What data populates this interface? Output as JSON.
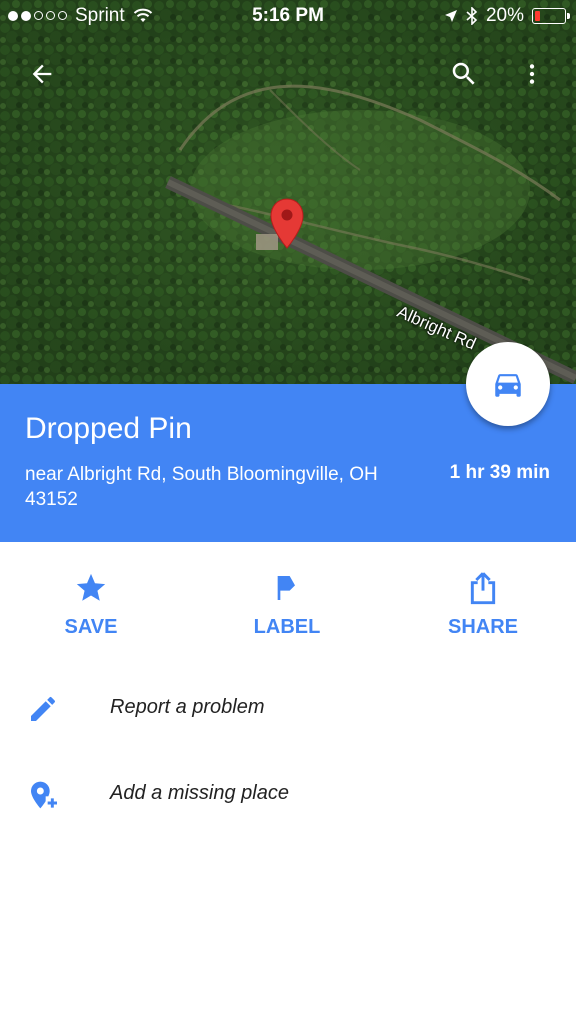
{
  "status_bar": {
    "carrier": "Sprint",
    "time": "5:16 PM",
    "battery": "20%",
    "battery_level": 0.2
  },
  "map": {
    "road_label": "Albright Rd"
  },
  "place": {
    "title": "Dropped Pin",
    "address": "near Albright Rd, South Bloomingville, OH 43152",
    "eta": "1 hr 39 min"
  },
  "actions": [
    {
      "label": "SAVE",
      "icon": "star-icon"
    },
    {
      "label": "LABEL",
      "icon": "flag-icon"
    },
    {
      "label": "SHARE",
      "icon": "share-icon"
    }
  ],
  "list": [
    {
      "label": "Report a problem",
      "icon": "pencil-icon"
    },
    {
      "label": "Add a missing place",
      "icon": "add-place-icon"
    }
  ],
  "colors": {
    "accent": "#4285f4",
    "pin": "#e53935",
    "battery_low": "#ff3b30"
  }
}
